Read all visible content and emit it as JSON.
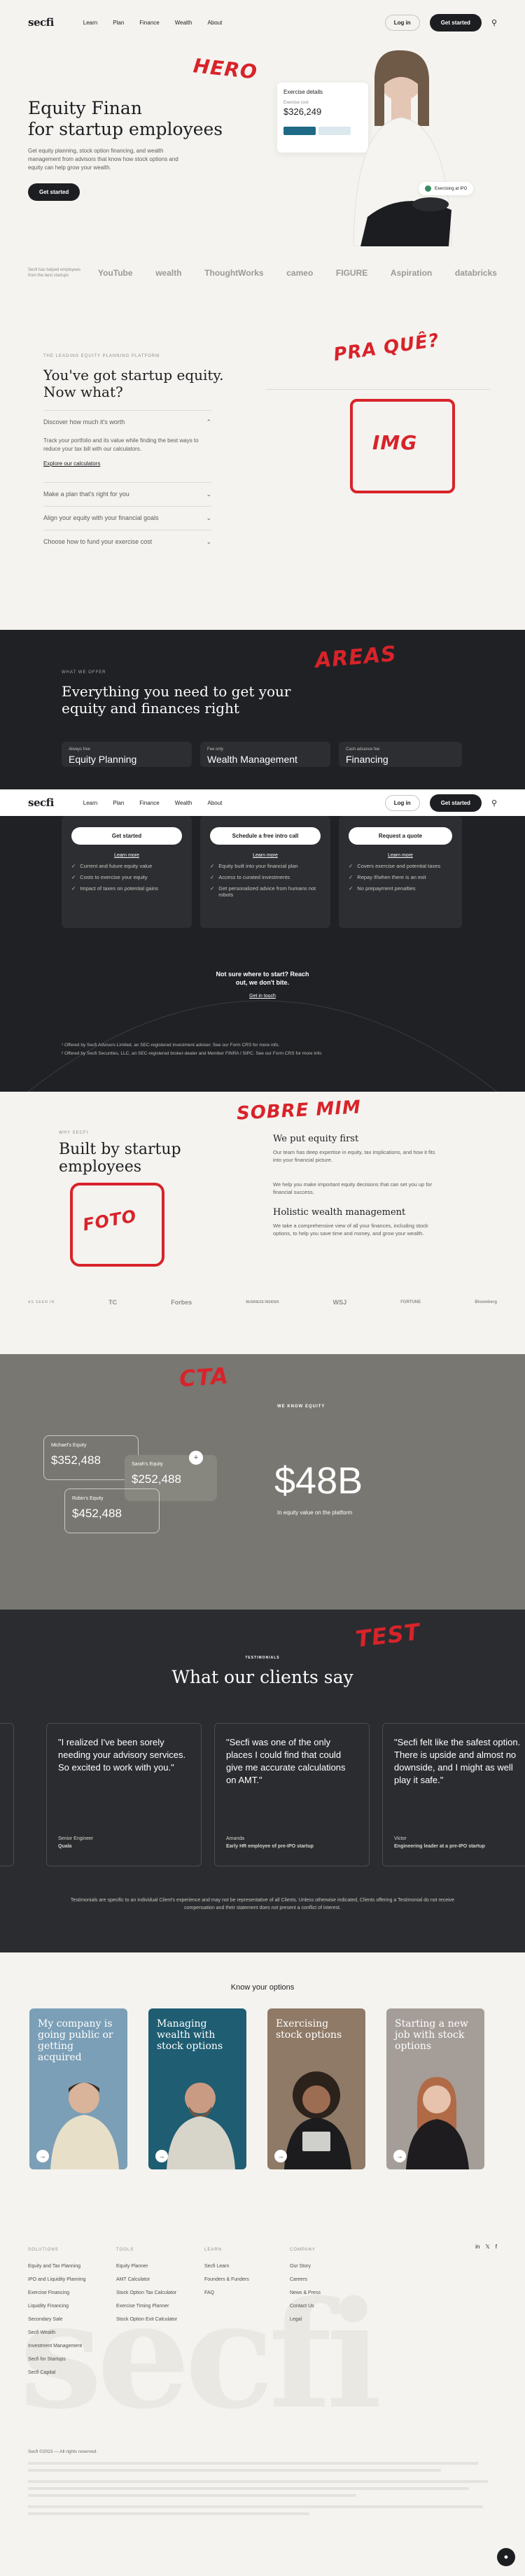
{
  "nav": {
    "logo": "secfi",
    "links": [
      "Learn",
      "Plan",
      "Finance",
      "Wealth",
      "About"
    ],
    "login": "Log in",
    "cta": "Get started"
  },
  "hero": {
    "title_line1": "Equity Finan",
    "title_line2": "for startup employees",
    "subtitle": "Get equity planning, stock option financing, and wealth management from advisors that know how stock options and equity can help grow your wealth.",
    "button": "Get started",
    "exercise_card_title": "Exercise details",
    "exercise_card_label": "Exercise cost",
    "exercise_card_value": "$326,249",
    "badge": "Exercising at IPO",
    "annotation": "HERO"
  },
  "backed": {
    "label": "Secfi has helped employees from the best startups",
    "brands": [
      "YouTube",
      "wealth",
      "ThoughtWorks",
      "cameo",
      "FIGURE",
      "Aspiration",
      "databricks"
    ]
  },
  "equity": {
    "eyebrow": "THE LEADING EQUITY PLANNING PLATFORM",
    "title": "You've got startup equity. Now what?",
    "question": "Discover how much it's worth",
    "body": "Track your portfolio and its value while finding the best ways to reduce your tax bill with our calculators.",
    "link": "Explore our calculators",
    "items": [
      "Make a plan that's right for you",
      "Align your equity with your financial goals",
      "Choose how to fund your exercise cost"
    ],
    "annotation_1": "PRA QUÊ?",
    "annotation_2": "IMG"
  },
  "offer": {
    "eyebrow": "WHAT WE OFFER",
    "title": "Everything you need to get your equity and finances right",
    "annotation": "AREAS",
    "cards": [
      {
        "tag": "Always free",
        "title": "Equity Planning",
        "button": "Get started",
        "link": "Learn more",
        "features": [
          "Current and future equity value",
          "Costs to exercise your equity",
          "Impact of taxes on potential gains"
        ]
      },
      {
        "tag": "Fee only",
        "title": "Wealth Management",
        "button": "Schedule a free intro call",
        "link": "Learn more",
        "features": [
          "Equity built into your financial plan",
          "Access to curated investments",
          "Get personalized advice from humans not robots"
        ]
      },
      {
        "tag": "Cash advance fee",
        "title": "Financing",
        "button": "Request a quote",
        "link": "Learn more",
        "features": [
          "Covers exercise and potential taxes",
          "Repay if/when there is an exit",
          "No prepayment penalties"
        ]
      }
    ],
    "help_title": "Not sure where to start? Reach out, we don't bite.",
    "help_link": "Get in touch",
    "fineprint_1": "¹ Offered by Secfi Advisors Limited, an SEC-registered investment adviser. See our Form CRS for more info.",
    "fineprint_2": "² Offered by Secfi Securities, LLC, an SEC-registered broker-dealer and Member FINRA / SIPC. See our Form CRS for more info."
  },
  "about": {
    "eyebrow": "WHY SECFI",
    "title": "Built by startup employees",
    "annotation_1": "SOBRE MIM",
    "annotation_2": "FOTO",
    "h1": "We put equity first",
    "p1": "Our team has deep expertise in equity, tax implications, and how it fits into your financial picture.",
    "p2": "We help you make important equity decisions that can set you up for financial success.",
    "h2": "Holistic wealth management",
    "p3": "We take a comprehensive view of all your finances, including stock options, to help you save time and money, and grow your wealth.",
    "press_label": "AS SEEN IN",
    "press": [
      "TC",
      "Forbes",
      "BUSINESS INSIDER",
      "WSJ",
      "FORTUNE",
      "Bloomberg"
    ]
  },
  "cta": {
    "annotation": "CTA",
    "eyebrow": "WE KNOW EQUITY",
    "value": "$48B",
    "caption": "In equity value on the platform",
    "cards": [
      {
        "label": "Michael's Equity",
        "value": "$352,488"
      },
      {
        "label": "Sarah's Equity",
        "value": "$252,488"
      },
      {
        "label": "Robin's Equity",
        "value": "$452,488"
      }
    ]
  },
  "testimonials": {
    "annotation": "TEST",
    "eyebrow": "TESTIMONIALS",
    "title": "What our clients say",
    "items": [
      {
        "quote": "\"I realized I've been sorely needing your advisory services. So excited to work with you.\"",
        "name": "Senior Engineer",
        "role": "Quala"
      },
      {
        "quote": "\"Secfi was one of the only places I could find that could give me accurate calculations on AMT.\"",
        "name": "Amanda",
        "role": "Early HR employee of pre-IPO startup"
      },
      {
        "quote": "\"Secfi felt like the safest option. There is upside and almost no downside, and I might as well play it safe.\"",
        "name": "Victor",
        "role": "Engineering leader at a pre-IPO startup"
      }
    ],
    "disclaimer": "Testimonials are specific to an individual Client's experience and may not be representative of all Clients. Unless otherwise indicated, Clients offering a Testimonial do not receive compensation and their statement does not present a conflict of interest."
  },
  "options": {
    "title": "Know your options",
    "tiles": [
      {
        "text": "My company is going public or getting acquired",
        "color": "#7b9fb6"
      },
      {
        "text": "Managing wealth with stock options",
        "color": "#1f5d72"
      },
      {
        "text": "Exercising stock options",
        "color": "#8f7a67"
      },
      {
        "text": "Starting a new job with stock options",
        "color": "#a59d98"
      }
    ]
  },
  "footer": {
    "cols": [
      {
        "head": "SOLUTIONS",
        "items": [
          "Equity and Tax Planning",
          "IPO and Liquidity Planning",
          "Exercise Financing",
          "Liquidity Financing",
          "Secondary Sale",
          "Secfi Wealth",
          "Investment Management",
          "Secfi for Startups",
          "Secfi Capital"
        ]
      },
      {
        "head": "TOOLS",
        "items": [
          "Equity Planner",
          "AMT Calculator",
          "Stock Option Tax Calculator",
          "Exercise Timing Planner",
          "Stock Option Exit Calculator"
        ]
      },
      {
        "head": "LEARN",
        "items": [
          "Secfi Learn",
          "Founders & Funders",
          "FAQ"
        ]
      },
      {
        "head": "COMPANY",
        "items": [
          "Our Story",
          "Careers",
          "News & Press",
          "Contact Us",
          "Legal"
        ]
      }
    ],
    "bigword": "secfi",
    "copyright": "Secfi ©2023 — All rights reserved."
  }
}
